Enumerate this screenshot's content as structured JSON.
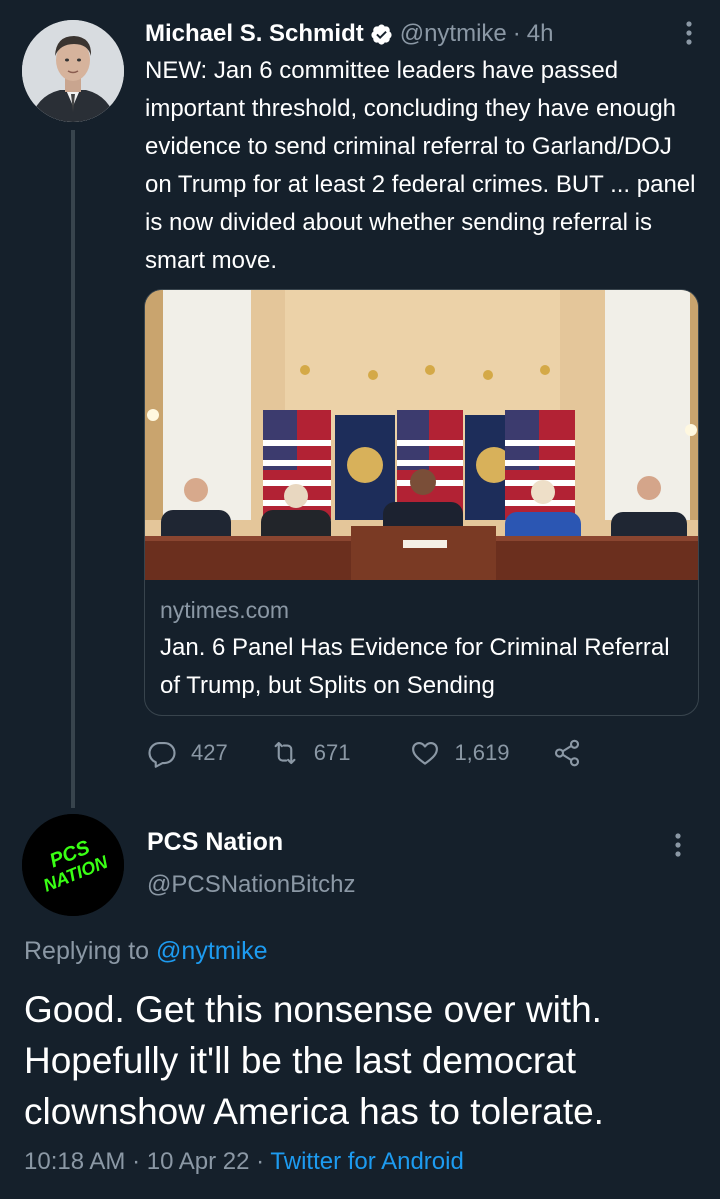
{
  "tweet1": {
    "author_name": "Michael S. Schmidt",
    "handle": "@nytmike",
    "separator": "·",
    "time": "4h",
    "text": "NEW: Jan 6 committee leaders have passed important threshold, concluding they have enough evidence to send criminal referral to Garland/DOJ on Trump for at least 2 federal crimes. BUT ... panel is now divided about whether sending referral is smart move.",
    "card": {
      "domain": "nytimes.com",
      "title": "Jan. 6 Panel Has Evidence for Criminal Referral of Trump, but Splits on Sending"
    },
    "counts": {
      "replies": "427",
      "retweets": "671",
      "likes": "1,619"
    }
  },
  "tweet2": {
    "author_name": "PCS Nation",
    "handle": "@PCSNationBitchz",
    "avatar_text_top": "PCS",
    "avatar_text_bottom": "NATION",
    "replying_prefix": "Replying to",
    "replying_handle": "@nytmike",
    "text": "Good. Get this nonsense over with. Hopefully it'll be the last democrat clownshow America has to tolerate.",
    "time": "10:18 AM",
    "separator1": "·",
    "date": "10 Apr 22",
    "separator2": "·",
    "source": "Twitter for Android"
  },
  "icons": {
    "verified": "verified-badge-icon",
    "more": "more-vertical-icon",
    "reply": "reply-icon",
    "retweet": "retweet-icon",
    "like": "heart-icon",
    "share": "share-icon"
  },
  "colors": {
    "background": "#15202b",
    "text_primary": "#ffffff",
    "text_secondary": "#8b98a5",
    "link": "#1d9bf0",
    "border": "#38444d",
    "avatar2_text": "#39ff14"
  }
}
